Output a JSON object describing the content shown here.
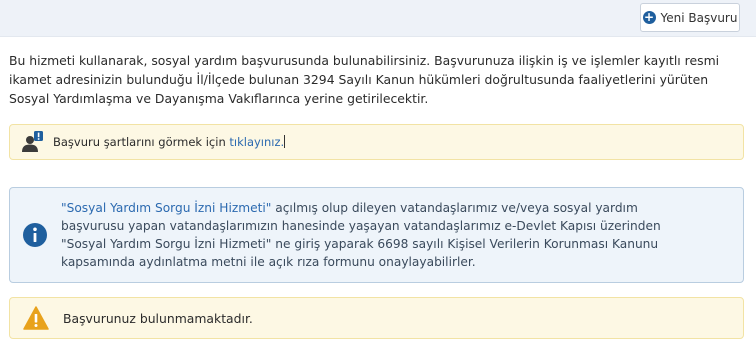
{
  "toolbar": {
    "new_application_label": "Yeni Başvuru"
  },
  "intro": {
    "text": "Bu hizmeti kullanarak, sosyal yardım başvurusunda bulunabilirsiniz. Başvurunuza ilişkin iş ve işlemler kayıtlı resmi ikamet adresinizin bulunduğu İl/İlçede bulunan 3294 Sayılı Kanun hükümleri doğrultusunda faaliyetlerini yürüten Sosyal Yardımlaşma ve Dayanışma Vakıflarınca yerine getirilecektir."
  },
  "requirements": {
    "text": "Başvuru şartlarını görmek için ",
    "link_label": "tıklayınız."
  },
  "info": {
    "service_name": "\"Sosyal Yardım Sorgu İzni Hizmeti\"",
    "text_part1": " açılmış olup dileyen vatandaşlarımız ve/veya sosyal yardım başvurusu yapan vatandaşlarımızın hanesinde yaşayan vatandaşlarımız e-Devlet Kapısı üzerinden \"Sosyal Yardım Sorgu İzni Hizmeti\" ne giriş yaparak 6698 sayılı Kişisel Verilerin Korunması Kanunu kapsamında aydınlatma metni ile açık rıza formunu onaylayabilirler."
  },
  "status": {
    "text": "Başvurunuz bulunmamaktadır."
  },
  "colors": {
    "accent": "#1f5f9e",
    "link": "#2c6ab0",
    "warning_bg": "#fdf8e4",
    "info_bg": "#eef4fa",
    "warning_icon": "#e8a21c"
  },
  "icons": {
    "new_button": "plus-circle-icon",
    "requirements": "user-alert-icon",
    "info": "info-circle-icon",
    "status": "warning-triangle-icon"
  }
}
